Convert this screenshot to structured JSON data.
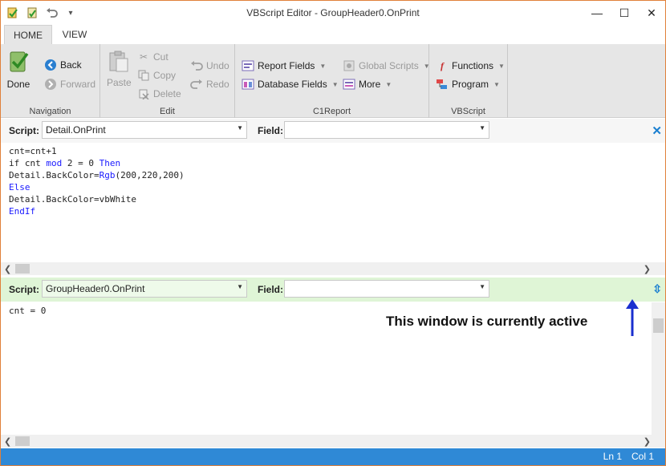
{
  "window": {
    "title": "VBScript Editor - GroupHeader0.OnPrint",
    "minimize": "—",
    "maximize": "☐",
    "close": "✕"
  },
  "tabs": [
    {
      "label": "HOME"
    },
    {
      "label": "VIEW"
    }
  ],
  "ribbon": {
    "navigation": {
      "label": "Navigation",
      "done": "Done",
      "back": "Back",
      "forward": "Forward"
    },
    "edit": {
      "label": "Edit",
      "paste": "Paste",
      "cut": "Cut",
      "copy": "Copy",
      "delete": "Delete",
      "undo": "Undo",
      "redo": "Redo"
    },
    "c1report": {
      "label": "C1Report",
      "report_fields": "Report Fields",
      "database_fields": "Database Fields",
      "global_scripts": "Global Scripts",
      "more": "More"
    },
    "vbscript": {
      "label": "VBScript",
      "functions": "Functions",
      "program": "Program"
    }
  },
  "pane1": {
    "script_label": "Script:",
    "script_value": "Detail.OnPrint",
    "field_label": "Field:",
    "field_value": "",
    "lines": [
      [
        {
          "t": "cnt=cnt+1"
        }
      ],
      [
        {
          "t": "if cnt "
        },
        {
          "t": "mod",
          "k": 1
        },
        {
          "t": " 2 = 0 "
        },
        {
          "t": "Then",
          "k": 1
        }
      ],
      [
        {
          "t": "Detail.BackColor="
        },
        {
          "t": "Rgb",
          "k": 1
        },
        {
          "t": "(200,220,200)"
        }
      ],
      [
        {
          "t": "Else",
          "k": 1
        }
      ],
      [
        {
          "t": "Detail.BackColor=vbWhite"
        }
      ],
      [
        {
          "t": "EndIf",
          "k": 1
        }
      ]
    ]
  },
  "pane2": {
    "script_label": "Script:",
    "script_value": "GroupHeader0.OnPrint",
    "field_label": "Field:",
    "field_value": "",
    "code": "cnt = 0",
    "active_bg": "#dff5d6"
  },
  "annotation": "This window is currently active",
  "status": {
    "ln": "Ln 1",
    "col": "Col 1",
    "color": "#2f89d6"
  }
}
